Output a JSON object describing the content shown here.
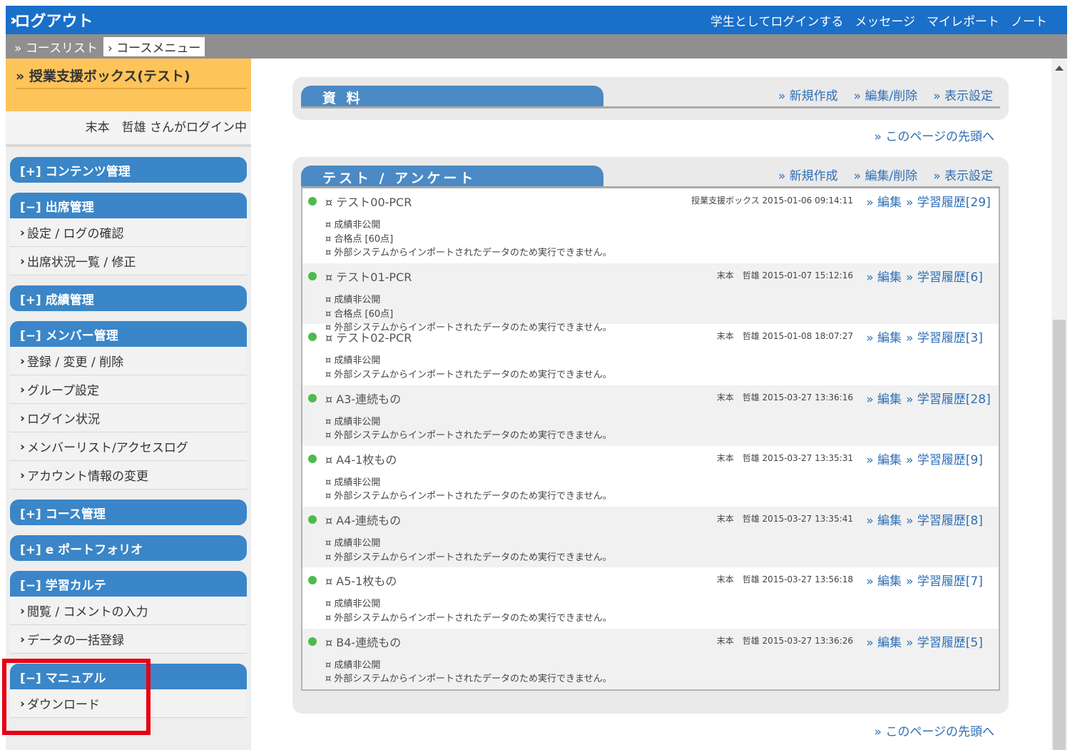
{
  "topbar": {
    "logout": "ログアウト",
    "links": [
      "学生としてログインする",
      "メッセージ",
      "マイレポート",
      "ノート"
    ]
  },
  "breadcrumb": [
    "コースリスト",
    "コースメニュー"
  ],
  "sidebar": {
    "course_title": "授業支援ボックス(テスト)",
    "login_user": "末本　哲雄 さんがログイン中",
    "sections": [
      {
        "label": "[+] コンテンツ管理",
        "items": []
      },
      {
        "label": "[−] 出席管理",
        "items": [
          "設定 / ログの確認",
          "出席状況一覧 / 修正"
        ]
      },
      {
        "label": "[+] 成績管理",
        "items": []
      },
      {
        "label": "[−] メンバー管理",
        "items": [
          "登録 / 変更 / 削除",
          "グループ設定",
          "ログイン状況",
          "メンバーリスト/アクセスログ",
          "アカウント情報の変更"
        ]
      },
      {
        "label": "[+] コース管理",
        "items": []
      },
      {
        "label": "[+] e ポートフォリオ",
        "items": []
      },
      {
        "label": "[−] 学習カルテ",
        "items": [
          "閲覧 / コメントの入力",
          "データの一括登録"
        ]
      },
      {
        "label": "[−] マニュアル",
        "items": [
          "ダウンロード"
        ]
      }
    ]
  },
  "materials": {
    "title": "資 料",
    "actions": [
      "» 新規作成",
      "» 編集/削除",
      "» 表示設定"
    ],
    "to_top": "» このページの先頭へ"
  },
  "tests": {
    "title": "テスト / アンケート",
    "actions": [
      "» 新規作成",
      "» 編集/削除",
      "» 表示設定"
    ],
    "to_top": "» このページの先頭へ",
    "rows": [
      {
        "title": "¤ テスト00-PCR",
        "meta": "授業支援ボックス 2015-01-06 09:14:11",
        "edit": "» 編集",
        "history": "» 学習履歴[29]",
        "notes": [
          "¤ 成績非公開",
          "¤ 合格点 [60点]",
          "¤ 外部システムからインポートされたデータのため実行できません。"
        ]
      },
      {
        "title": "¤ テスト01-PCR",
        "meta": "末本　哲雄 2015-01-07 15:12:16",
        "edit": "» 編集",
        "history": "» 学習履歴[6]",
        "notes": [
          "¤ 成績非公開",
          "¤ 合格点 [60点]",
          "¤ 外部システムからインポートされたデータのため実行できません。"
        ]
      },
      {
        "title": "¤ テスト02-PCR",
        "meta": "末本　哲雄 2015-01-08 18:07:27",
        "edit": "» 編集",
        "history": "» 学習履歴[3]",
        "notes": [
          "¤ 成績非公開",
          "¤ 外部システムからインポートされたデータのため実行できません。"
        ]
      },
      {
        "title": "¤ A3-連続もの",
        "meta": "末本　哲雄 2015-03-27 13:36:16",
        "edit": "» 編集",
        "history": "» 学習履歴[28]",
        "notes": [
          "¤ 成績非公開",
          "¤ 外部システムからインポートされたデータのため実行できません。"
        ]
      },
      {
        "title": "¤ A4-1枚もの",
        "meta": "末本　哲雄 2015-03-27 13:35:31",
        "edit": "» 編集",
        "history": "» 学習履歴[9]",
        "notes": [
          "¤ 成績非公開",
          "¤ 外部システムからインポートされたデータのため実行できません。"
        ]
      },
      {
        "title": "¤ A4-連続もの",
        "meta": "末本　哲雄 2015-03-27 13:35:41",
        "edit": "» 編集",
        "history": "» 学習履歴[8]",
        "notes": [
          "¤ 成績非公開",
          "¤ 外部システムからインポートされたデータのため実行できません。"
        ]
      },
      {
        "title": "¤ A5-1枚もの",
        "meta": "末本　哲雄 2015-03-27 13:56:18",
        "edit": "» 編集",
        "history": "» 学習履歴[7]",
        "notes": [
          "¤ 成績非公開",
          "¤ 外部システムからインポートされたデータのため実行できません。"
        ]
      },
      {
        "title": "¤ B4-連続もの",
        "meta": "末本　哲雄 2015-03-27 13:36:26",
        "edit": "» 編集",
        "history": "» 学習履歴[5]",
        "notes": [
          "¤ 成績非公開",
          "¤ 外部システムからインポートされたデータのため実行できません。"
        ]
      }
    ]
  },
  "colors": {
    "topbar": "#1a6fc9",
    "section_head": "#3a86c8",
    "course_box": "#fdc45a",
    "link": "#2f6fb5",
    "status_dot": "#4dbb4a",
    "highlight": "#e60012"
  }
}
